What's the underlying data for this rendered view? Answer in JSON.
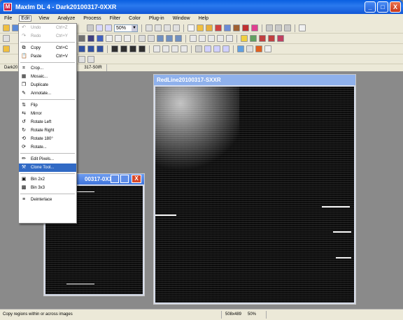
{
  "app": {
    "title": "Maxlm DL 4 - Dark20100317-0XXR",
    "icon_glyph": "M"
  },
  "window_controls": {
    "minimize": "_",
    "maximize": "□",
    "close": "X"
  },
  "menubar": [
    "File",
    "Edit",
    "View",
    "Analyze",
    "Process",
    "Filter",
    "Color",
    "Plug-in",
    "Window",
    "Help"
  ],
  "toolbar": {
    "zoom_value": "50%"
  },
  "tabs": [
    "Dark20",
    "317-S0IR"
  ],
  "edit_menu": {
    "items": [
      {
        "label": "Undo",
        "shortcut": "Ctrl+Z",
        "icon": "undo-icon",
        "glyph": "↶",
        "disabled": true
      },
      {
        "label": "Redo",
        "shortcut": "Ctrl+Y",
        "icon": "redo-icon",
        "glyph": "↷",
        "disabled": true
      },
      {
        "sep": true
      },
      {
        "label": "Copy",
        "shortcut": "Ctrl+C",
        "icon": "copy-icon",
        "glyph": "⧉"
      },
      {
        "label": "Paste",
        "shortcut": "Ctrl+V",
        "icon": "paste-icon",
        "glyph": "📋"
      },
      {
        "sep": true
      },
      {
        "label": "Crop...",
        "icon": "crop-icon",
        "glyph": "⌗"
      },
      {
        "label": "Mosaic...",
        "icon": "mosaic-icon",
        "glyph": "▦"
      },
      {
        "label": "Duplicate",
        "icon": "duplicate-icon",
        "glyph": "❐"
      },
      {
        "label": "Annotate...",
        "icon": "annotate-icon",
        "glyph": "✎"
      },
      {
        "sep": true
      },
      {
        "label": "Flip",
        "icon": "flip-icon",
        "glyph": "⇅"
      },
      {
        "label": "Mirror",
        "icon": "mirror-icon",
        "glyph": "⇆"
      },
      {
        "label": "Rotate Left",
        "icon": "rotate-left-icon",
        "glyph": "↺"
      },
      {
        "label": "Rotate Right",
        "icon": "rotate-right-icon",
        "glyph": "↻"
      },
      {
        "label": "Rotate 180°",
        "icon": "rotate-180-icon",
        "glyph": "⟲"
      },
      {
        "label": "Rotate...",
        "icon": "rotate-icon",
        "glyph": "⟳"
      },
      {
        "sep": true
      },
      {
        "label": "Edit Pixels...",
        "icon": "pencil-icon",
        "glyph": "✏"
      },
      {
        "label": "Clone Tool...",
        "icon": "clone-icon",
        "glyph": "⚒",
        "highlighted": true
      },
      {
        "sep": true
      },
      {
        "label": "Bin 2x2",
        "icon": "bin-2x2-icon",
        "glyph": "▣"
      },
      {
        "label": "Bin 3x3",
        "icon": "bin-3x3-icon",
        "glyph": "▩"
      },
      {
        "sep": true
      },
      {
        "label": "Deinterlace",
        "icon": "deinterlace-icon",
        "glyph": "≡"
      }
    ]
  },
  "windows": {
    "red": {
      "title": "RedLine20100317-SXXR"
    },
    "dark": {
      "title": "00317-0XXR"
    }
  },
  "statusbar": {
    "message": "Copy regions within or across images",
    "dimensions": "508x489",
    "zoom": "50%"
  }
}
